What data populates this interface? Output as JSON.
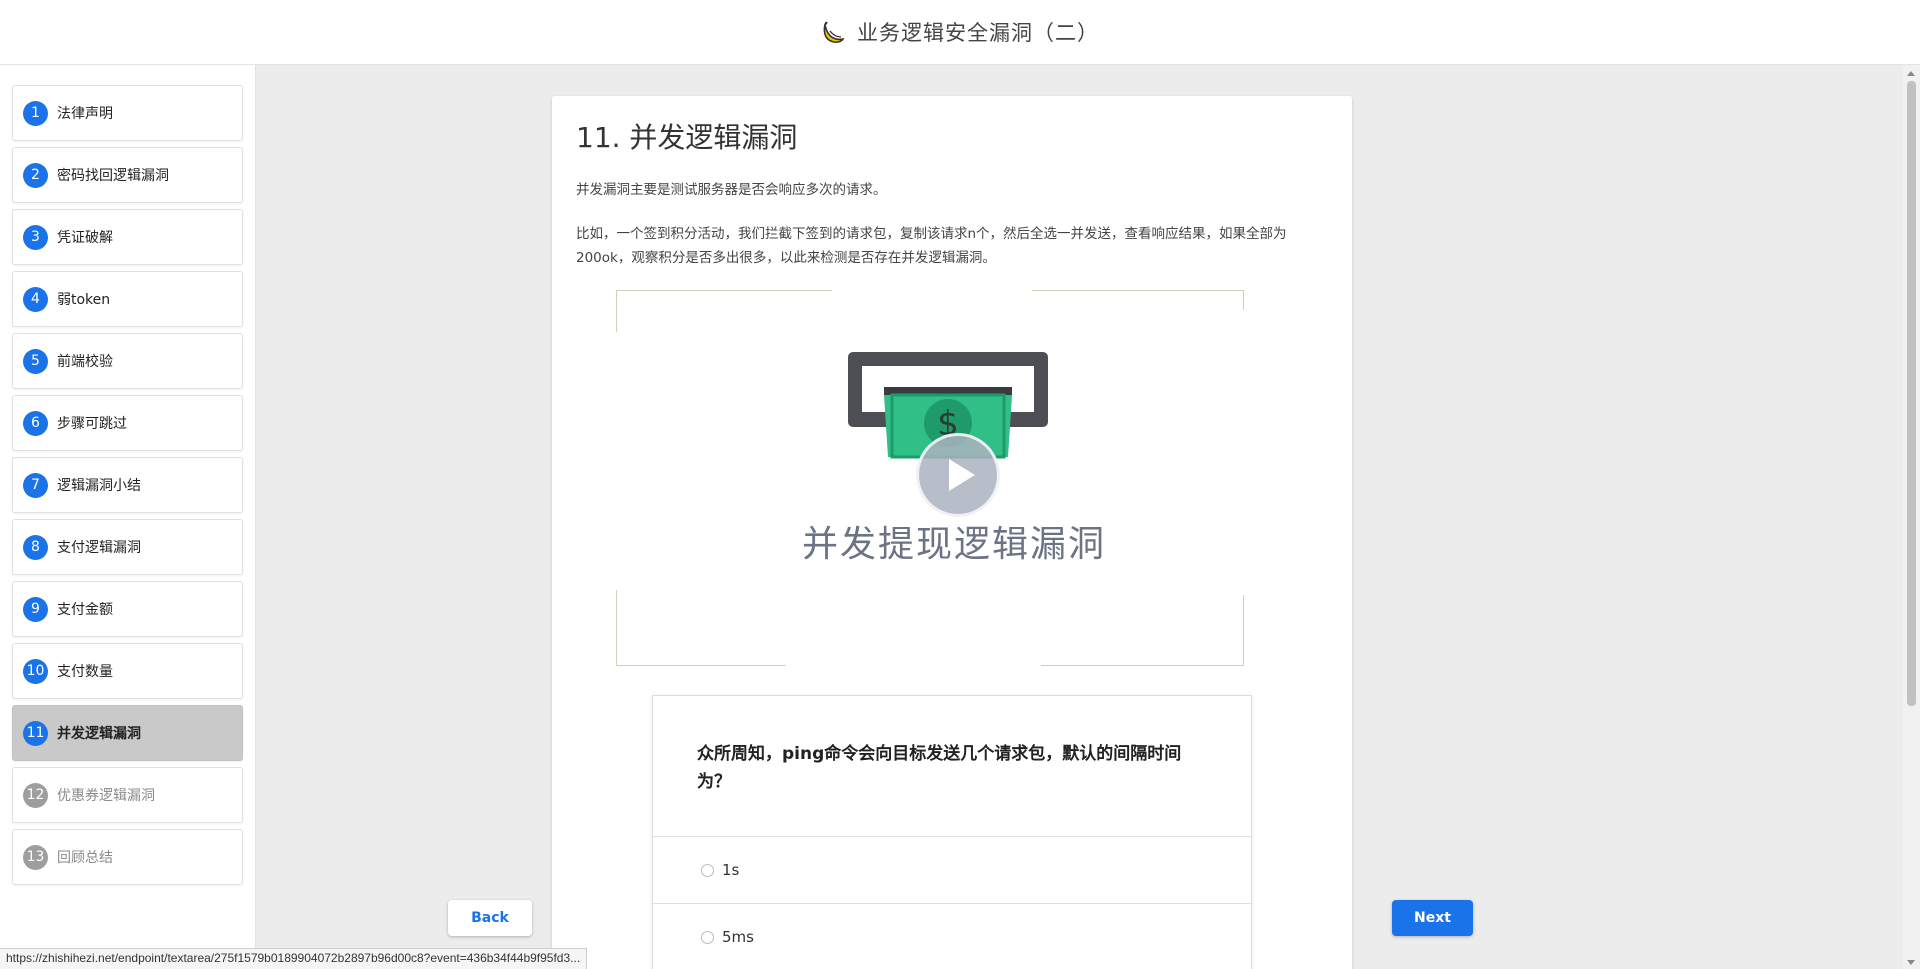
{
  "header": {
    "title": "业务逻辑安全漏洞（二）"
  },
  "sidebar": {
    "items": [
      {
        "num": "1",
        "label": "法律声明"
      },
      {
        "num": "2",
        "label": "密码找回逻辑漏洞"
      },
      {
        "num": "3",
        "label": "凭证破解"
      },
      {
        "num": "4",
        "label": "弱token"
      },
      {
        "num": "5",
        "label": "前端校验"
      },
      {
        "num": "6",
        "label": "步骤可跳过"
      },
      {
        "num": "7",
        "label": "逻辑漏洞小结"
      },
      {
        "num": "8",
        "label": "支付逻辑漏洞"
      },
      {
        "num": "9",
        "label": "支付金额"
      },
      {
        "num": "10",
        "label": "支付数量"
      },
      {
        "num": "11",
        "label": "并发逻辑漏洞"
      },
      {
        "num": "12",
        "label": "优惠券逻辑漏洞"
      },
      {
        "num": "13",
        "label": "回顾总结"
      }
    ]
  },
  "main": {
    "title": "11. 并发逻辑漏洞",
    "para1": "并发漏洞主要是测试服务器是否会响应多次的请求。",
    "para2": "比如，一个签到积分活动，我们拦截下签到的请求包，复制该请求n个，然后全选一并发送，查看响应结果，如果全部为200ok，观察积分是否多出很多，以此来检测是否存在并发逻辑漏洞。",
    "video_caption": "并发提现逻辑漏洞"
  },
  "quiz": {
    "question": "众所周知，ping命令会向目标发送几个请求包，默认的间隔时间为？",
    "options": [
      "1s",
      "5ms"
    ]
  },
  "buttons": {
    "back": "Back",
    "next": "Next"
  },
  "statusbar": {
    "url": "https://zhishihezi.net/endpoint/textarea/275f1579b0189904072b2897b96d00c8?event=436b34f44b9f95fd3..."
  },
  "colors": {
    "accent": "#1a73e8",
    "active_bg": "#c9c9c9",
    "money_green": "#2fbf87"
  }
}
